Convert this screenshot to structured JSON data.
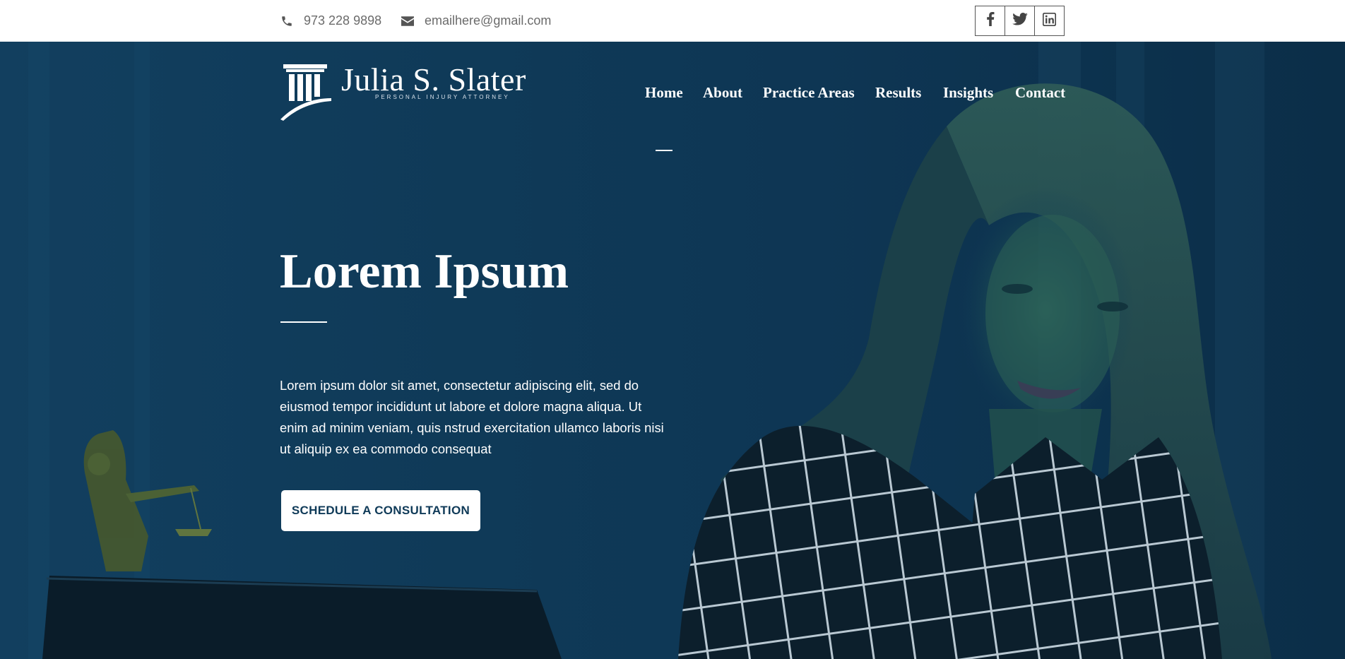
{
  "topbar": {
    "phone": "973 228 9898",
    "email": "emailhere@gmail.com",
    "phone_icon": "phone-icon",
    "email_icon": "envelope-icon",
    "socials": [
      "facebook-icon",
      "twitter-icon",
      "linkedin-icon"
    ]
  },
  "header": {
    "logo_name": "Julia S. Slater",
    "logo_tagline": "PERSONAL INJURY ATTORNEY",
    "logo_icon": "pillar-icon",
    "nav": {
      "home": "Home",
      "about": "About",
      "practice": "Practice Areas",
      "results": "Results",
      "insights": "Insights",
      "contact": "Contact"
    },
    "active_nav": "Home"
  },
  "hero": {
    "title": "Lorem Ipsum",
    "body": "Lorem ipsum dolor sit amet, consectetur adipiscing elit, sed do eiusmod tempor incididunt ut labore et dolore magna aliqua. Ut enim ad minim veniam, quis nstrud exercitation ullamco laboris nisi ut aliquip ex ea commodo consequat",
    "cta": "SCHEDULE A CONSULTATION"
  },
  "colors": {
    "overlay": "#0f3a58",
    "text_gray": "#6b6b6b",
    "cta_text": "#0f3a58"
  }
}
